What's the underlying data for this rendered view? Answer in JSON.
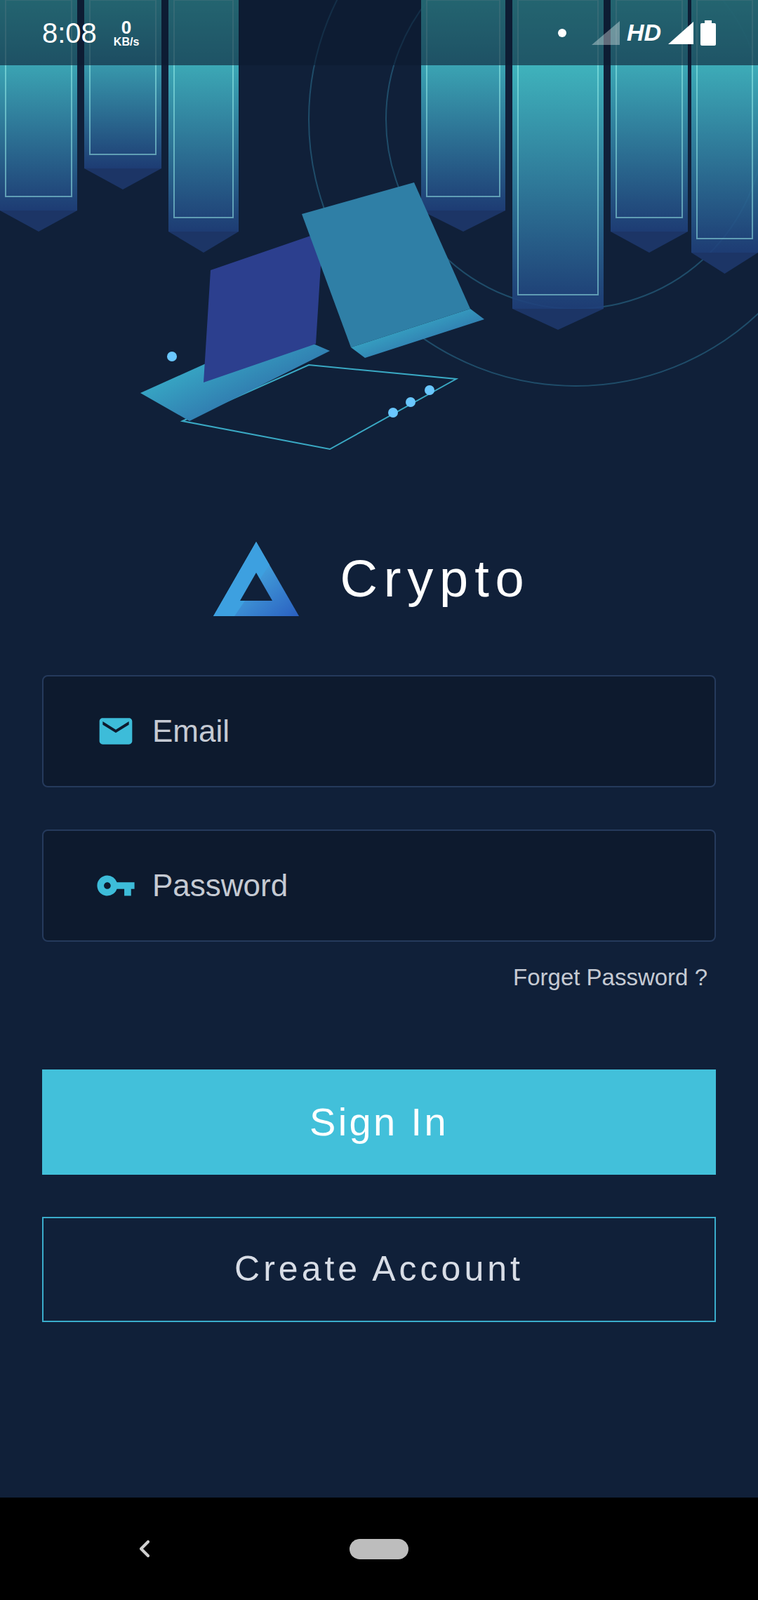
{
  "status_bar": {
    "time": "8:08",
    "speed": "0",
    "speed_unit": "KB/s",
    "network": "HD"
  },
  "app": {
    "name": "Crypto"
  },
  "fields": [
    {
      "placeholder": "Email",
      "kind": "email"
    },
    {
      "placeholder": "Password",
      "kind": "password"
    }
  ],
  "forgot_link": "Forget Password ?",
  "buttons": {
    "primary": "Sign In",
    "secondary": "Create Account"
  }
}
